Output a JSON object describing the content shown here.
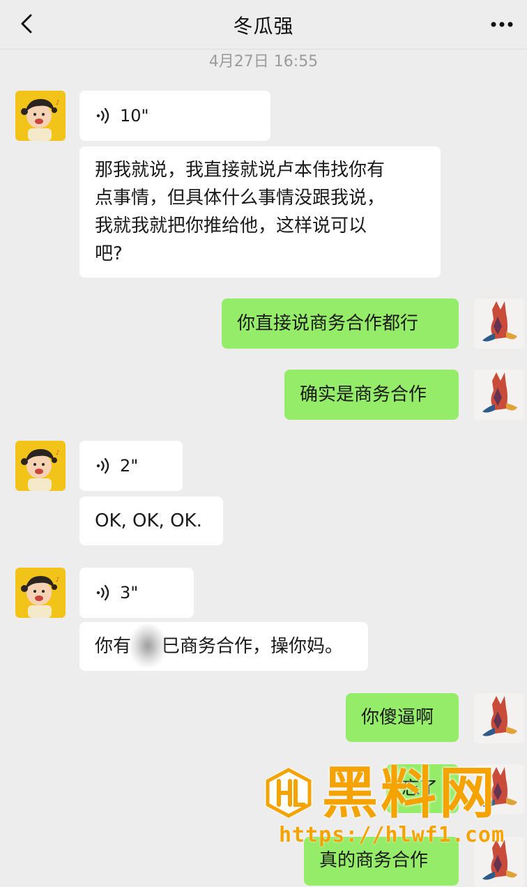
{
  "header": {
    "title": "冬瓜强",
    "back_icon": "chevron-left-icon",
    "more_icon": "more-dots-icon"
  },
  "timestamp": "4月27日 16:55",
  "messages": [
    {
      "side": "left",
      "type": "voice",
      "duration": "10\""
    },
    {
      "side": "left",
      "type": "text",
      "lines": [
        "那我就说，我直接就说卢本伟找你有",
        "点事情，但具体什么事情没跟我说，",
        "我就我就把你推给他，这样说可以",
        "吧?"
      ]
    },
    {
      "side": "right",
      "type": "text",
      "text": "你直接说商务合作都行"
    },
    {
      "side": "right",
      "type": "text",
      "text": "确实是商务合作"
    },
    {
      "side": "left",
      "type": "voice",
      "duration": "2\""
    },
    {
      "side": "left",
      "type": "text",
      "text": "OK, OK, OK."
    },
    {
      "side": "left",
      "type": "voice",
      "duration": "3\""
    },
    {
      "side": "left",
      "type": "text",
      "text_a": "你有",
      "text_b": "巳商务合作，操你妈。"
    },
    {
      "side": "right",
      "type": "text",
      "text": "你傻逼啊"
    },
    {
      "side": "right",
      "type": "text",
      "text": "忘了"
    },
    {
      "side": "right",
      "type": "text",
      "text": "真的商务合作"
    }
  ],
  "watermark": {
    "title": "黑料网",
    "url": "https://hlwf1.com"
  },
  "colors": {
    "background": "#ededed",
    "sent_bubble": "#95ec69",
    "received_bubble": "#ffffff",
    "watermark": "#f5a300"
  }
}
